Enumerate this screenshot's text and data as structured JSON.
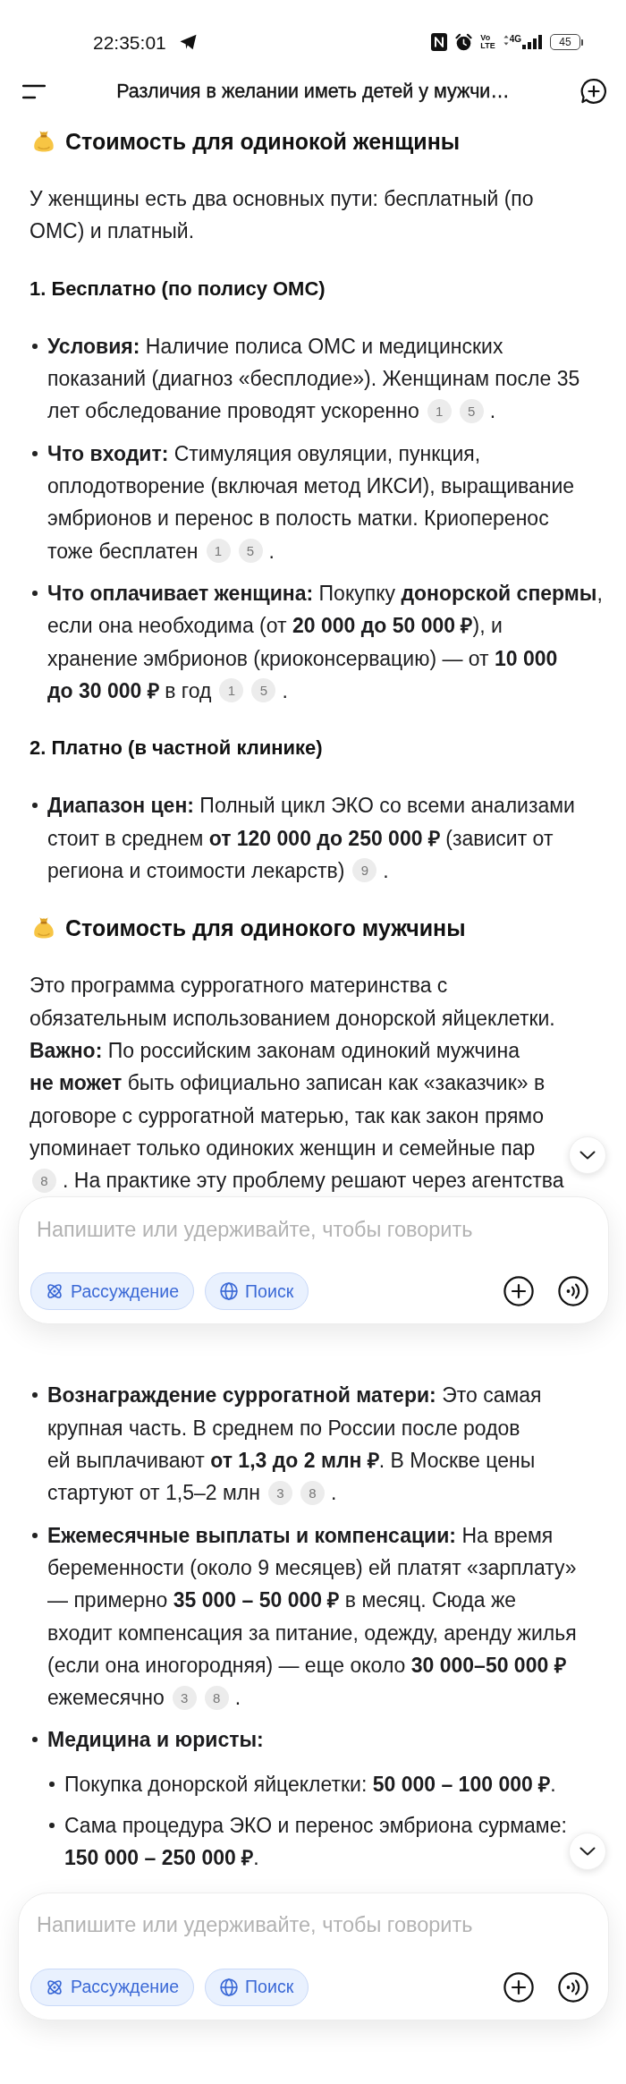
{
  "status_bar": {
    "time": "22:35:01",
    "volte": [
      "Vo",
      "LTE"
    ],
    "network": "4G",
    "battery": "45"
  },
  "top_bar": {
    "title": "Различия в желании иметь детей у мужчи…"
  },
  "screens": [
    {
      "blocks": [
        {
          "kind": "section_heading",
          "text": "Стоимость для одинокой женщины"
        },
        {
          "kind": "paragraph",
          "lines": [
            [
              {
                "kind": "text",
                "text": "У женщины есть два основных пути: бесплатный (по"
              }
            ],
            [
              {
                "kind": "text",
                "text": "ОМС) и платный."
              }
            ]
          ]
        },
        {
          "kind": "subheading",
          "text": "1. Бесплатно (по полису ОМС)"
        },
        {
          "kind": "bullet_list",
          "items": [
            {
              "kind": "entry",
              "lines": [
                [
                  {
                    "kind": "text",
                    "text": "**Условия:** Наличие полиса ОМС и медицинских"
                  }
                ],
                [
                  {
                    "kind": "text",
                    "text": "показаний (диагноз «бесплодие»). Женщинам после 35"
                  }
                ],
                [
                  {
                    "kind": "text",
                    "text": "лет обследование проводят ускоренно"
                  },
                  {
                    "kind": "citation",
                    "text": "1"
                  },
                  {
                    "kind": "citation",
                    "text": "5"
                  },
                  {
                    "kind": "text",
                    "text": "."
                  }
                ]
              ]
            },
            {
              "kind": "entry",
              "lines": [
                [
                  {
                    "kind": "text",
                    "text": "**Что входит:** Стимуляция овуляции, пункция,"
                  }
                ],
                [
                  {
                    "kind": "text",
                    "text": "оплодотворение (включая метод ИКСИ), выращивание"
                  }
                ],
                [
                  {
                    "kind": "text",
                    "text": "эмбрионов и перенос в полость матки. Криоперенос"
                  }
                ],
                [
                  {
                    "kind": "text",
                    "text": "тоже бесплатен"
                  },
                  {
                    "kind": "citation",
                    "text": "1"
                  },
                  {
                    "kind": "citation",
                    "text": "5"
                  },
                  {
                    "kind": "text",
                    "text": "."
                  }
                ]
              ]
            },
            {
              "kind": "entry",
              "lines": [
                [
                  {
                    "kind": "text",
                    "text": "**Что оплачивает женщина:** Покупку **донорской спермы**,"
                  }
                ],
                [
                  {
                    "kind": "text",
                    "text": "если она необходима (от **20 000 до 50 000 ₽**), и"
                  }
                ],
                [
                  {
                    "kind": "text",
                    "text": "хранение эмбрионов (криоконсервацию) — от **10 000**"
                  }
                ],
                [
                  {
                    "kind": "text",
                    "text": "**до 30 000 ₽** в год"
                  },
                  {
                    "kind": "citation",
                    "text": "1"
                  },
                  {
                    "kind": "citation",
                    "text": "5"
                  },
                  {
                    "kind": "text",
                    "text": "."
                  }
                ]
              ]
            }
          ]
        },
        {
          "kind": "subheading",
          "text": "2. Платно (в частной клинике)"
        },
        {
          "kind": "bullet_list",
          "items": [
            {
              "kind": "entry",
              "lines": [
                [
                  {
                    "kind": "text",
                    "text": "**Диапазон цен:** Полный цикл ЭКО со всеми анализами"
                  }
                ],
                [
                  {
                    "kind": "text",
                    "text": "стоит в среднем **от 120 000 до 250 000 ₽** (зависит от"
                  }
                ],
                [
                  {
                    "kind": "text",
                    "text": "региона и стоимости лекарств)"
                  },
                  {
                    "kind": "citation",
                    "text": "9"
                  },
                  {
                    "kind": "text",
                    "text": "."
                  }
                ]
              ]
            }
          ]
        },
        {
          "kind": "section_heading",
          "text": "Стоимость для одинокого мужчины"
        },
        {
          "kind": "paragraph",
          "lines": [
            [
              {
                "kind": "text",
                "text": "Это программа суррогатного материнства с"
              }
            ],
            [
              {
                "kind": "text",
                "text": "обязательным использованием донорской яйцеклетки."
              }
            ],
            [
              {
                "kind": "text",
                "text": "**Важно:** По российским законам одинокий мужчина"
              }
            ],
            [
              {
                "kind": "text",
                "text": "**не может** быть официально записан как «заказчик» в"
              }
            ],
            [
              {
                "kind": "text",
                "text": "договоре с суррогатной матерью, так как закон прямо"
              }
            ],
            [
              {
                "kind": "text",
                "text": "упоминает только одиноких женщин и семейные пар"
              }
            ],
            [
              {
                "kind": "citation",
                "text": "8"
              },
              {
                "kind": "text",
                "text": ". На практике эту проблему решают через агентства"
              }
            ]
          ]
        }
      ],
      "composer": {
        "placeholder": "Напишите или удерживайте, чтобы говорить",
        "toggles": [
          {
            "kind": "reasoning",
            "label": "Рассуждение",
            "selected": true
          },
          {
            "kind": "search",
            "label": "Поиск",
            "selected": true
          }
        ]
      }
    },
    {
      "blocks": [
        {
          "kind": "bullet_list",
          "items": [
            {
              "kind": "entry",
              "lines": [
                [
                  {
                    "kind": "text",
                    "text": "**Вознаграждение суррогатной матери:** Это самая"
                  }
                ],
                [
                  {
                    "kind": "text",
                    "text": "крупная часть. В среднем по России после родов"
                  }
                ],
                [
                  {
                    "kind": "text",
                    "text": "ей выплачивают **от 1,3 до 2 млн ₽**. В Москве цены"
                  }
                ],
                [
                  {
                    "kind": "text",
                    "text": "стартуют от 1,5–2 млн"
                  },
                  {
                    "kind": "citation",
                    "text": "3"
                  },
                  {
                    "kind": "citation",
                    "text": "8"
                  },
                  {
                    "kind": "text",
                    "text": "."
                  }
                ]
              ]
            },
            {
              "kind": "entry",
              "lines": [
                [
                  {
                    "kind": "text",
                    "text": "**Ежемесячные выплаты и компенсации:** На время"
                  }
                ],
                [
                  {
                    "kind": "text",
                    "text": "беременности (около 9 месяцев) ей платят «зарплату»"
                  }
                ],
                [
                  {
                    "kind": "text",
                    "text": "— примерно **35 000 – 50 000 ₽** в месяц. Сюда же"
                  }
                ],
                [
                  {
                    "kind": "text",
                    "text": "входит компенсация за питание, одежду, аренду жилья"
                  }
                ],
                [
                  {
                    "kind": "text",
                    "text": "(если она иногородняя) — еще около **30 000–50 000 ₽**"
                  }
                ],
                [
                  {
                    "kind": "text",
                    "text": "ежемесячно"
                  },
                  {
                    "kind": "citation",
                    "text": "3"
                  },
                  {
                    "kind": "citation",
                    "text": "8"
                  },
                  {
                    "kind": "text",
                    "text": "."
                  }
                ]
              ]
            },
            {
              "kind": "group",
              "lines": [
                [
                  {
                    "kind": "text",
                    "text": "Медицина и юристы:"
                  }
                ]
              ],
              "children": [
                {
                  "kind": "entry",
                  "lines": [
                    [
                      {
                        "kind": "text",
                        "text": "Покупка донорской яйцеклетки: **50 000 – 100 000 ₽**."
                      }
                    ]
                  ]
                },
                {
                  "kind": "entry",
                  "lines": [
                    [
                      {
                        "kind": "text",
                        "text": "Сама процедура ЭКО и перенос эмбриона сурмаме:"
                      }
                    ],
                    [
                      {
                        "kind": "text",
                        "text": "**150 000 – 250 000 ₽**."
                      }
                    ]
                  ]
                }
              ]
            }
          ]
        }
      ],
      "composer": {
        "placeholder": "Напишите или удерживайте, чтобы говорить",
        "toggles": [
          {
            "kind": "reasoning",
            "label": "Рассуждение",
            "selected": true
          },
          {
            "kind": "search",
            "label": "Поиск",
            "selected": true
          }
        ]
      }
    }
  ]
}
